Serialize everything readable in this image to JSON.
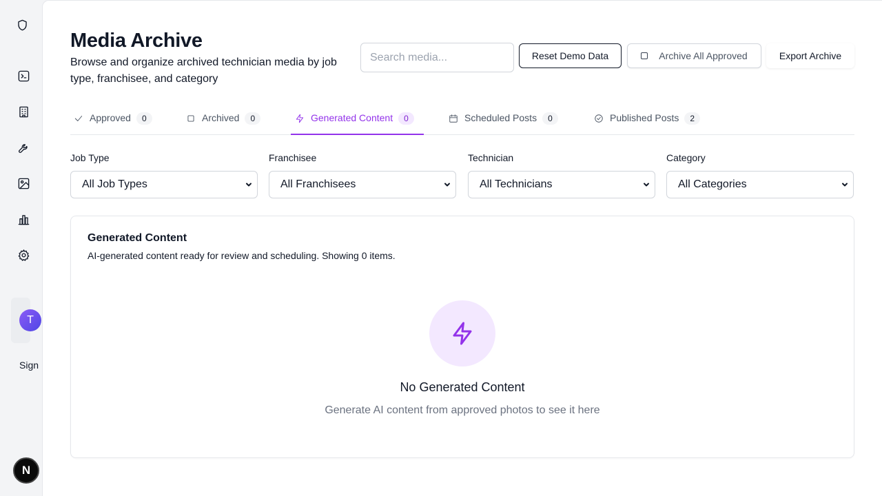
{
  "sidebar": {
    "icons": [
      "shield-icon",
      "terminal-icon",
      "building-icon",
      "wrench-icon",
      "image-icon",
      "bar-chart-icon",
      "gear-icon"
    ],
    "user_initial": "T",
    "sign_label": "Sign",
    "dev_badge": "N"
  },
  "header": {
    "title": "Media Archive",
    "subtitle": "Browse and organize archived technician media by job type, franchisee, and category",
    "search_placeholder": "Search media...",
    "reset_label": "Reset Demo Data",
    "archive_all_label": "Archive All Approved",
    "export_label": "Export Archive"
  },
  "tabs": [
    {
      "label": "Approved",
      "count": "0",
      "icon": "check-icon"
    },
    {
      "label": "Archived",
      "count": "0",
      "icon": "square-icon"
    },
    {
      "label": "Generated Content",
      "count": "0",
      "icon": "zap-icon",
      "active": true
    },
    {
      "label": "Scheduled Posts",
      "count": "0",
      "icon": "calendar-icon"
    },
    {
      "label": "Published Posts",
      "count": "2",
      "icon": "check-circle-icon"
    }
  ],
  "filters": [
    {
      "label": "Job Type",
      "value": "All Job Types"
    },
    {
      "label": "Franchisee",
      "value": "All Franchisees"
    },
    {
      "label": "Technician",
      "value": "All Technicians"
    },
    {
      "label": "Category",
      "value": "All Categories"
    }
  ],
  "content": {
    "title": "Generated Content",
    "description": "AI-generated content ready for review and scheduling. Showing 0 items.",
    "empty_title": "No Generated Content",
    "empty_description": "Generate AI content from approved photos to see it here"
  },
  "colors": {
    "accent": "#9333ea",
    "accent_light": "#f3e8ff",
    "text": "#111827",
    "muted": "#6b7280"
  }
}
